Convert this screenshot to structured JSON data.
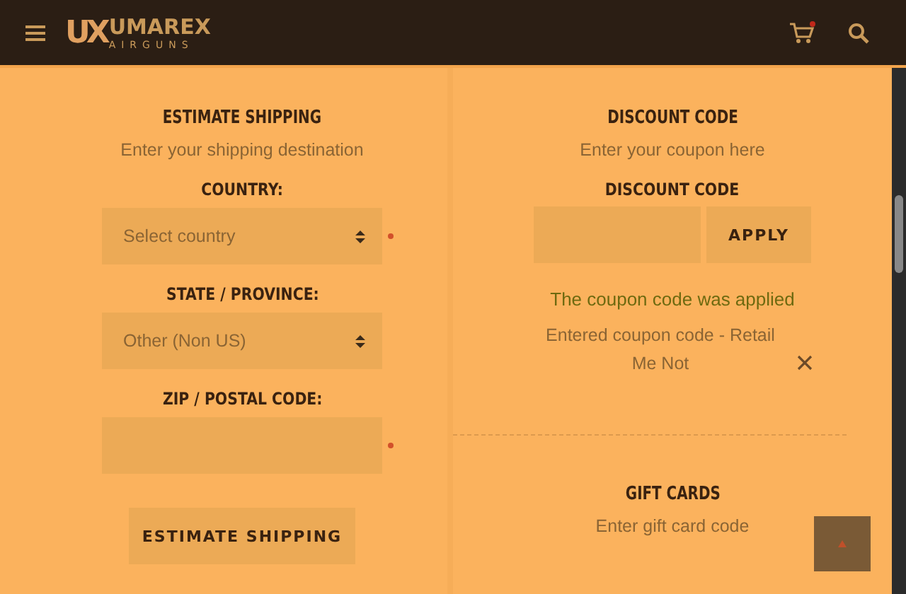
{
  "header": {
    "logo_mark": "UX",
    "logo_name": "UMAREX",
    "logo_sub": "AIRGUNS"
  },
  "shipping": {
    "title": "ESTIMATE SHIPPING",
    "hint": "Enter your shipping destination",
    "fields": [
      {
        "kind": "select",
        "label": "COUNTRY:",
        "value": "Select country",
        "required": true
      },
      {
        "kind": "select",
        "label": "STATE / PROVINCE:",
        "value": "Other (Non US)",
        "required": false
      },
      {
        "kind": "text",
        "label": "ZIP / POSTAL CODE:",
        "required": true
      }
    ],
    "button": "ESTIMATE SHIPPING"
  },
  "discount": {
    "title": "DISCOUNT CODE",
    "hint": "Enter your coupon here",
    "label": "DISCOUNT CODE",
    "button": "APPLY",
    "success": "The coupon code was applied",
    "entered": "Entered coupon code - Retail Me Not"
  },
  "gift": {
    "title": "GIFT CARDS",
    "hint": "Enter gift card code"
  }
}
